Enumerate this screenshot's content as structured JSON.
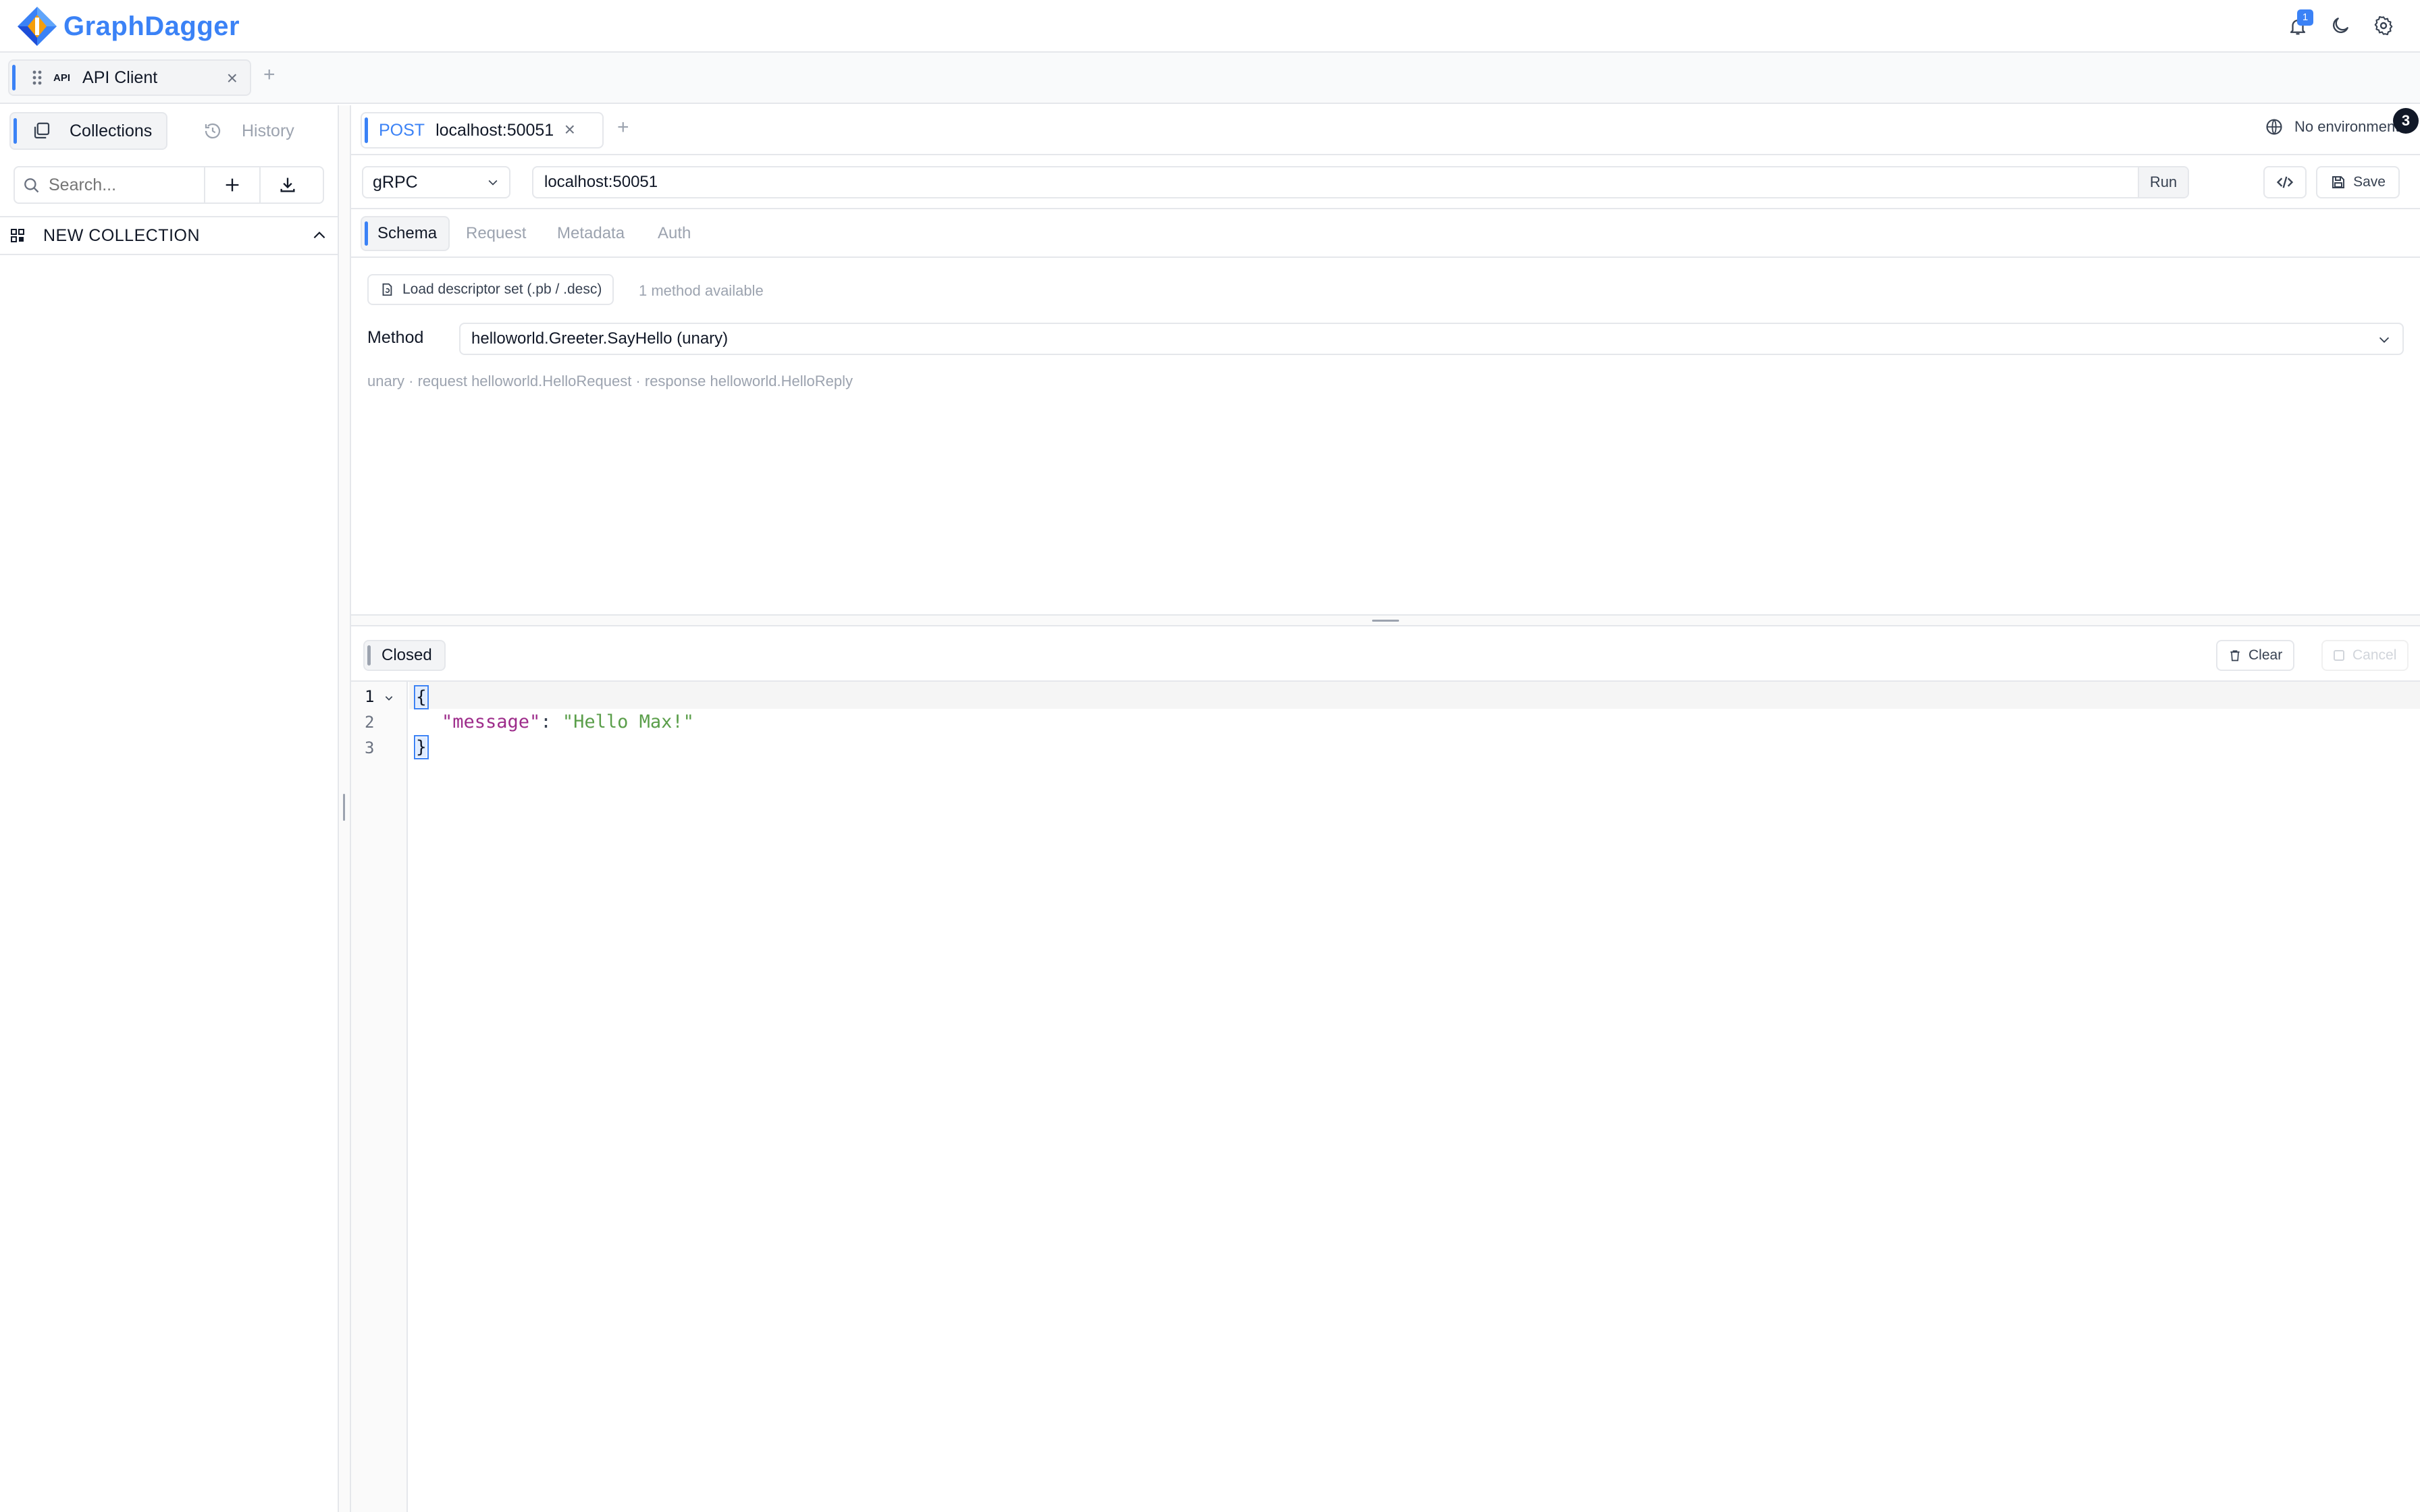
{
  "app": {
    "name": "GraphDagger"
  },
  "header": {
    "notification_count": "1"
  },
  "window_tabs": [
    {
      "badge": "API",
      "label": "API Client"
    }
  ],
  "sidebar": {
    "tabs": [
      {
        "label": "Collections"
      },
      {
        "label": "History"
      }
    ],
    "search_placeholder": "Search...",
    "collection": {
      "name": "NEW COLLECTION"
    }
  },
  "request_tabs": [
    {
      "method": "POST",
      "url": "localhost:50051"
    }
  ],
  "environment": {
    "label": "No environment",
    "badge": "3"
  },
  "request": {
    "protocol": "gRPC",
    "url": "localhost:50051",
    "run_label": "Run",
    "save_label": "Save"
  },
  "sub_tabs": [
    {
      "label": "Schema"
    },
    {
      "label": "Request"
    },
    {
      "label": "Metadata"
    },
    {
      "label": "Auth"
    }
  ],
  "schema": {
    "load_button": "Load descriptor set (.pb / .desc)",
    "methods_available": "1 method available",
    "method_label": "Method",
    "method_value": "helloworld.Greeter.SayHello (unary)",
    "method_info": "unary · request helloworld.HelloRequest · response helloworld.HelloReply"
  },
  "response": {
    "status": "Closed",
    "clear_label": "Clear",
    "cancel_label": "Cancel",
    "lines": [
      {
        "num": "1",
        "open_brace": "{"
      },
      {
        "num": "2",
        "key": "\"message\"",
        "colon": ": ",
        "value": "\"Hello Max!\""
      },
      {
        "num": "3",
        "close_brace": "}"
      }
    ]
  },
  "colors": {
    "accent": "#3b82f6",
    "json_key": "#9d2b8a",
    "json_string": "#5a9e4a"
  }
}
